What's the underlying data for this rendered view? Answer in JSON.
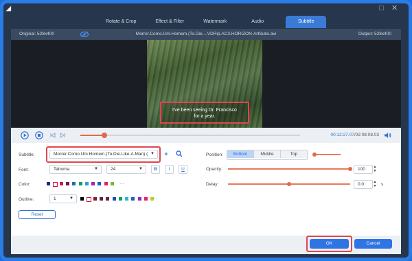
{
  "tabs": [
    {
      "label": "Rotate & Crop",
      "active": false
    },
    {
      "label": "Effect & Filter",
      "active": false
    },
    {
      "label": "Watermark",
      "active": false
    },
    {
      "label": "Audio",
      "active": false
    },
    {
      "label": "Subtitle",
      "active": true
    }
  ],
  "info": {
    "original": "Original: 528x400",
    "filename": "Morrer.Como.Um.Homem.(To.Die....VDRip.AC3.HORIZON-ArtSubs.avi",
    "output": "Output: 528x400"
  },
  "video": {
    "subtitle_line1": "I've been seeing Dr. Francisco",
    "subtitle_line2": "for a year."
  },
  "playback": {
    "progress": 0.11,
    "current_time": "00:12:27.07",
    "separator": "/",
    "total_time": "02:08:08.03"
  },
  "subtitle_settings": {
    "subtitle_label": "Subtitle:",
    "subtitle_value": "Morrer.Como.Um.Homem.(To.Die.Like.A.Man).(",
    "font_label": "Font:",
    "font_value": "Tahoma",
    "size_value": "24",
    "bold_glyph": "B",
    "italic_glyph": "I",
    "underline_glyph": "U",
    "color_label": "Color:",
    "color_more": "···",
    "outline_label": "Outline:",
    "outline_value": "1",
    "outline_more": "···",
    "reset_label": "Reset",
    "position_label": "Position:",
    "positions": [
      "Bottom",
      "Middle",
      "Top"
    ],
    "position_selected": "Bottom",
    "opacity_label": "Opacity:",
    "opacity_value": "100",
    "opacity_fraction": 1.0,
    "delay_label": "Delay:",
    "delay_value": "0.0",
    "delay_unit": "s",
    "delay_fraction": 0.5
  },
  "swatch_colors": [
    "#1b2a8a",
    "#ffffff",
    "#c9184a",
    "#6a1b4d",
    "#1f6fb3",
    "#159c62",
    "#2a9fd8",
    "#9c27b0",
    "#1565c0",
    "#e91e63",
    "#7cb342"
  ],
  "outline_swatch_colors": [
    "#000000",
    "#ffffff",
    "#8b1a2c",
    "#6a1b4d",
    "#7a1f3a",
    "#1f4fb3",
    "#159c62",
    "#29b6d8",
    "#1565c0",
    "#9c27b0",
    "#e91e63",
    "#c0ca33"
  ],
  "buttons": {
    "ok": "OK",
    "cancel": "Cancel"
  },
  "accent_color": "#2f74e3",
  "highlight_color": "#e2454e"
}
